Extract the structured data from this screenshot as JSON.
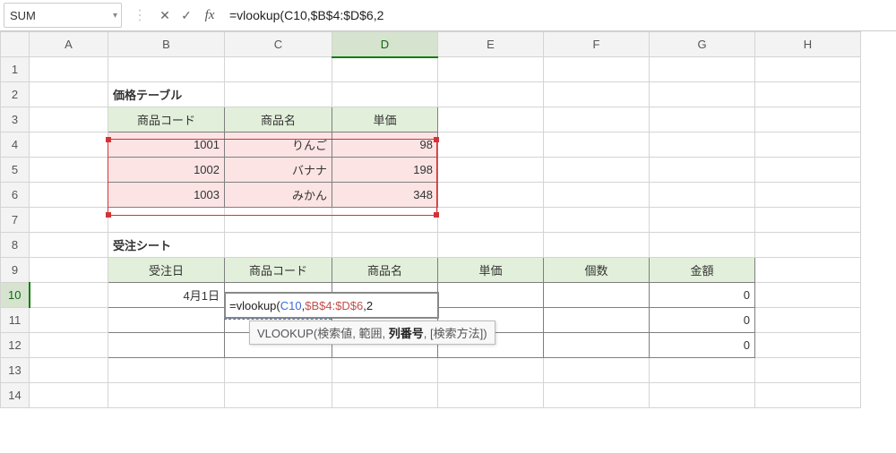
{
  "nameBox": "SUM",
  "formulaBar": {
    "cancel_icon": "✕",
    "enter_icon": "✓",
    "fx_label": "fx",
    "formula_text": "=vlookup(C10,$B$4:$D$6,2"
  },
  "columns": [
    "A",
    "B",
    "C",
    "D",
    "E",
    "F",
    "G",
    "H"
  ],
  "rows": [
    "1",
    "2",
    "3",
    "4",
    "5",
    "6",
    "7",
    "8",
    "9",
    "10",
    "11",
    "12",
    "13",
    "14"
  ],
  "priceTable": {
    "title": "価格テーブル",
    "headers": [
      "商品コード",
      "商品名",
      "単価"
    ],
    "rows": [
      {
        "code": "1001",
        "name": "りんご",
        "price": "98"
      },
      {
        "code": "1002",
        "name": "バナナ",
        "price": "198"
      },
      {
        "code": "1003",
        "name": "みかん",
        "price": "348"
      }
    ]
  },
  "orderSheet": {
    "title": "受注シート",
    "headers": [
      "受注日",
      "商品コード",
      "商品名",
      "単価",
      "個数",
      "金額"
    ],
    "rows": [
      {
        "date": "4月1日",
        "amount": "0"
      },
      {
        "date": "",
        "amount": "0"
      },
      {
        "date": "",
        "amount": "0"
      }
    ]
  },
  "editingCell": {
    "prefix": "=vlookup(",
    "ref1": "C10",
    "sep1": ",",
    "ref2": "$B$4:$D$6",
    "sep2": ",",
    "arg3": "2"
  },
  "argTip": {
    "fn": "VLOOKUP",
    "o": "(",
    "a1": "検索値",
    "s": ", ",
    "a2": "範囲",
    "a3": "列番号",
    "a4": "[検索方法]",
    "c": ")"
  },
  "chart_data": {
    "type": "table",
    "tables": [
      {
        "title": "価格テーブル",
        "columns": [
          "商品コード",
          "商品名",
          "単価"
        ],
        "rows": [
          [
            "1001",
            "りんご",
            98
          ],
          [
            "1002",
            "バナナ",
            198
          ],
          [
            "1003",
            "みかん",
            348
          ]
        ]
      },
      {
        "title": "受注シート",
        "columns": [
          "受注日",
          "商品コード",
          "商品名",
          "単価",
          "個数",
          "金額"
        ],
        "rows": [
          [
            "4月1日",
            null,
            null,
            null,
            null,
            0
          ],
          [
            null,
            null,
            null,
            null,
            null,
            0
          ],
          [
            null,
            null,
            null,
            null,
            null,
            0
          ]
        ]
      }
    ]
  }
}
